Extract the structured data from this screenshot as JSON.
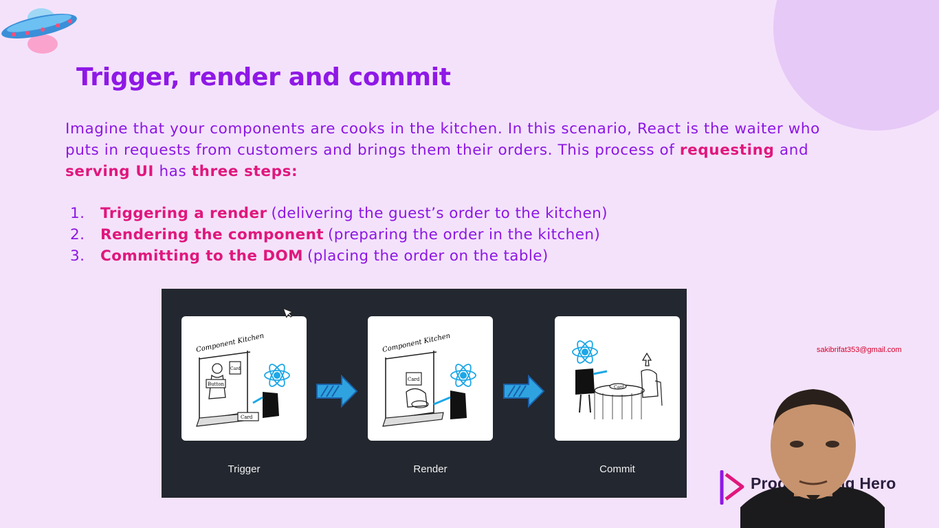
{
  "slide": {
    "title": "Trigger, render and commit",
    "intro": {
      "part1": "Imagine that your components are cooks in the kitchen. In this scenario, React is the waiter who puts in requests from customers and brings them their orders. This process of ",
      "hl1": "requesting",
      "part2": " and ",
      "hl2": "serving UI",
      "part3": " has ",
      "hl3": "three steps:"
    },
    "steps": [
      {
        "num": "1.",
        "bold": "Triggering a render",
        "rest": "(delivering the guest’s order to the kitchen)"
      },
      {
        "num": "2.",
        "bold": "Rendering the component",
        "rest": "(preparing the order in the kitchen)"
      },
      {
        "num": "3.",
        "bold": "Committing to the DOM",
        "rest": "(placing the order on the table)"
      }
    ]
  },
  "diagram": {
    "stages": [
      {
        "label": "Trigger"
      },
      {
        "label": "Render"
      },
      {
        "label": "Commit"
      }
    ],
    "sketch_text": {
      "kitchen_sign": "Component Kitchen",
      "button_tag": "Button",
      "card_tag": "Card"
    }
  },
  "overlay": {
    "email": "sakibrifat353@gmail.com",
    "brand": "Programming Hero"
  },
  "colors": {
    "background": "#f4e2fb",
    "title": "#8f18e6",
    "highlight": "#e0177d",
    "diagram_bg": "#23272f",
    "react_blue": "#1ea7e6"
  },
  "icons": [
    "ufo-icon",
    "react-logo-icon",
    "arrow-right-icon",
    "cursor-icon",
    "programming-hero-logo-icon"
  ]
}
